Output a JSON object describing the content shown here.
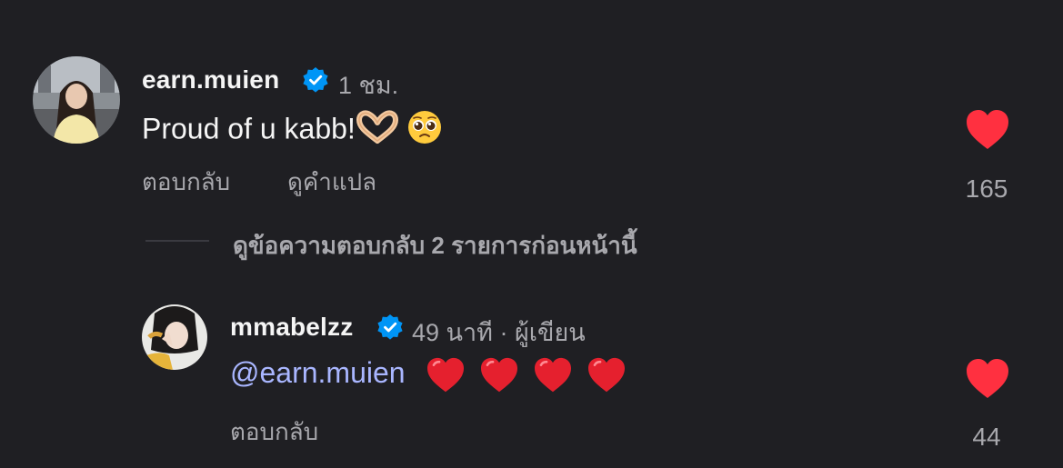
{
  "comments": [
    {
      "username": "earn.muien",
      "time": "1 ชม.",
      "text": "Proud of u kabb!",
      "reply_label": "ตอบกลับ",
      "translate_label": "ดูคำแปล",
      "likes": "165"
    }
  ],
  "replies_toggle": {
    "label": "ดูข้อความตอบกลับ 2 รายการก่อนหน้านี้"
  },
  "replies": [
    {
      "username": "mmabelzz",
      "time": "49 นาที · ผู้เขียน",
      "mention": "@earn.muien",
      "reply_label": "ตอบกลับ",
      "likes": "44"
    }
  ],
  "colors": {
    "background": "#1f1f23",
    "heart": "#ff3040",
    "verified": "#0095f6",
    "mention": "#a9b6ff",
    "secondary_text": "#a8a8ad"
  }
}
